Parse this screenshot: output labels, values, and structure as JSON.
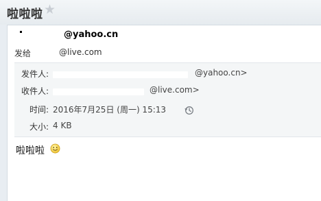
{
  "subject": {
    "title": "啦啦啦"
  },
  "header": {
    "from_domain": "@yahoo.cn",
    "to_label": "发给",
    "to_domain": "@live.com"
  },
  "details": {
    "sender_label": "发件人:",
    "sender_domain": "@yahoo.cn>",
    "recipient_label": "收件人:",
    "recipient_domain": "@live.com>",
    "time_label": "时间:",
    "time_value": "2016年7月25日 (周一) 15:13",
    "size_label": "大小:",
    "size_value": "4 KB"
  },
  "body": {
    "text": "啦啦啦"
  },
  "icons": {
    "star": "star-icon",
    "clock": "clock-history-icon",
    "smiley": "smiley-emoji-icon"
  }
}
